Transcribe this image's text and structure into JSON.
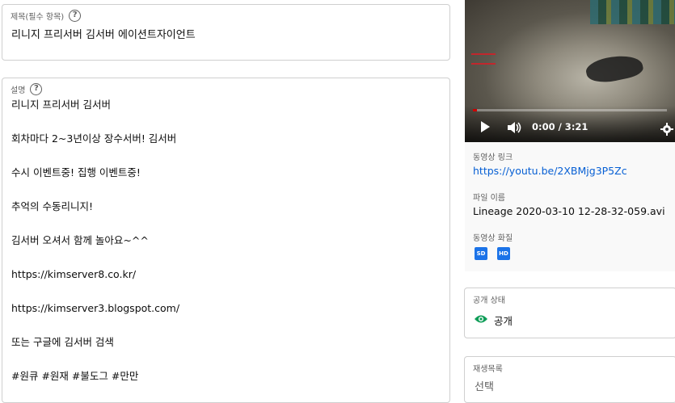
{
  "title_field": {
    "label": "제목(필수 항목)",
    "help_icon": "help-circle-icon",
    "value": "리니지 프리서버 김서버 에이션트자이언트"
  },
  "description_field": {
    "label": "설명",
    "help_icon": "help-circle-icon",
    "lines": [
      "리니지 프리서버 김서버",
      "회차마다 2~3년이상 장수서버! 김서버",
      "수시 이벤트중! 집행 이벤트중!",
      "추억의 수동리니지!",
      "김서버 오셔서 함께 놀아요~^^",
      "https://kimserver8.co.kr/",
      "https://kimserver3.blogspot.com/",
      "또는 구글에 김서버 검색",
      "#원큐 #원재 #불도그 #만만"
    ]
  },
  "video": {
    "time": "0:00 / 3:21",
    "progress": 0.02,
    "controls": [
      "play-icon",
      "volume-icon",
      "settings-gear-icon"
    ],
    "accent_color": "#cc0000"
  },
  "video_info": {
    "link_label": "동영상 링크",
    "link": "https://youtu.be/2XBMjg3P5Zc",
    "filename_label": "파일 이름",
    "filename": "Lineage 2020-03-10 12-28-32-059.avi",
    "quality_label": "동영상 화질",
    "qualities": [
      "SD",
      "HD"
    ],
    "link_color": "#065fd4"
  },
  "visibility": {
    "label": "공개 상태",
    "value": "공개",
    "icon": "eye-icon",
    "icon_color": "#0f9d58"
  },
  "playlist": {
    "label": "재생목록",
    "value": "선택"
  }
}
